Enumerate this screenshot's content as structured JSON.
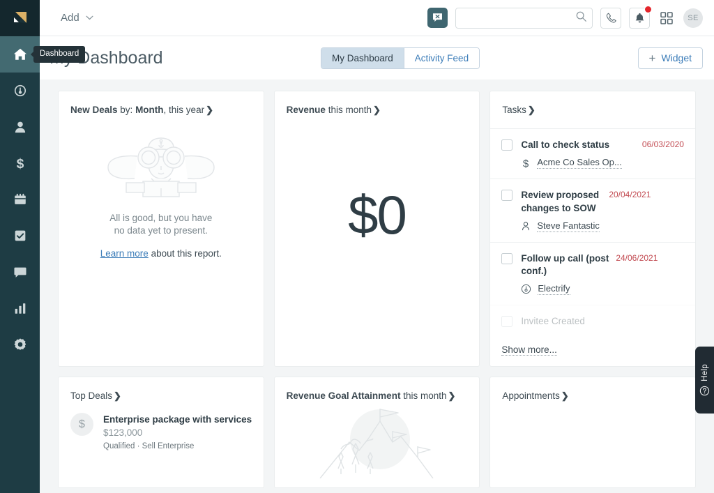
{
  "app": {
    "logo_name": "logo-mark",
    "sidebar": {
      "items": [
        {
          "name": "dashboard",
          "icon": "home-icon",
          "active": true
        },
        {
          "name": "leads",
          "icon": "lead-target-icon",
          "active": false
        },
        {
          "name": "contacts",
          "icon": "person-icon",
          "active": false
        },
        {
          "name": "deals",
          "icon": "dollar-icon",
          "active": false
        },
        {
          "name": "calendar",
          "icon": "calendar-icon",
          "active": false
        },
        {
          "name": "tasks",
          "icon": "task-check-icon",
          "active": false
        },
        {
          "name": "messages",
          "icon": "chat-bubble-icon",
          "active": false
        },
        {
          "name": "reports",
          "icon": "bar-chart-icon",
          "active": false
        },
        {
          "name": "settings",
          "icon": "gear-icon",
          "active": false
        }
      ],
      "tooltip": "Dashboard"
    }
  },
  "topbar": {
    "add_label": "Add",
    "search_placeholder": "",
    "search_value": "",
    "avatar_initials": "SE",
    "icons": {
      "chat": "chat-close-icon",
      "search": "search-icon",
      "phone": "phone-icon",
      "bell": "bell-icon",
      "grid": "grid-apps-icon"
    },
    "notification_dot": true
  },
  "header": {
    "title": "My Dashboard",
    "tabs": [
      {
        "label": "My Dashboard",
        "active": true
      },
      {
        "label": "Activity Feed",
        "active": false
      }
    ],
    "widget_button": {
      "plus": "+",
      "label": "Widget"
    }
  },
  "cards": {
    "new_deals": {
      "title_bold": "New Deals",
      "title_mid": " by: ",
      "title_bold2": "Month",
      "title_rest": ", this year",
      "chevron": "❯",
      "empty_line1": "All is good, but you have",
      "empty_line2": "no data yet to present.",
      "link_text": "Learn more",
      "link_suffix": " about this report."
    },
    "revenue": {
      "title_bold": "Revenue",
      "title_rest": " this month",
      "chevron": "❯",
      "value": "$0"
    },
    "tasks": {
      "title": "Tasks",
      "chevron": "❯",
      "show_more": "Show more...",
      "items": [
        {
          "name": "Call to check status",
          "date": "06/03/2020",
          "related": "Acme Co Sales Op...",
          "related_icon": "dollar-icon",
          "faded": false
        },
        {
          "name": "Review proposed changes to SOW",
          "date": "20/04/2021",
          "related": "Steve Fantastic",
          "related_icon": "person-icon",
          "faded": false
        },
        {
          "name": "Follow up call (post conf.)",
          "date": "24/06/2021",
          "related": "Electrify",
          "related_icon": "lead-target-icon",
          "faded": false
        },
        {
          "name": "Invitee Created",
          "date": "",
          "related": "",
          "related_icon": "",
          "faded": true
        }
      ]
    },
    "top_deals": {
      "title": "Top Deals",
      "chevron": "❯",
      "items": [
        {
          "avatar_glyph": "$",
          "name": "Enterprise package with services",
          "amount": "$123,000",
          "sub": "Qualified · Sell Enterprise"
        }
      ]
    },
    "revenue_goal": {
      "title_bold": "Revenue Goal Attainment",
      "title_rest": " this month",
      "chevron": "❯"
    },
    "appointments": {
      "title": "Appointments",
      "chevron": "❯"
    }
  },
  "help": {
    "label": "Help",
    "icon": "question-circle-icon"
  },
  "colors": {
    "sidebar_bg": "#1e3c44",
    "sidebar_active": "#436a71",
    "logo_gold": "#dbb066",
    "accent_link": "#3b7cb8",
    "tab_active_bg": "#cfdeea",
    "date_red": "#c24b52",
    "notification_red": "#e4262c",
    "content_bg": "#f3f5f6",
    "help_bg": "#212b33"
  }
}
